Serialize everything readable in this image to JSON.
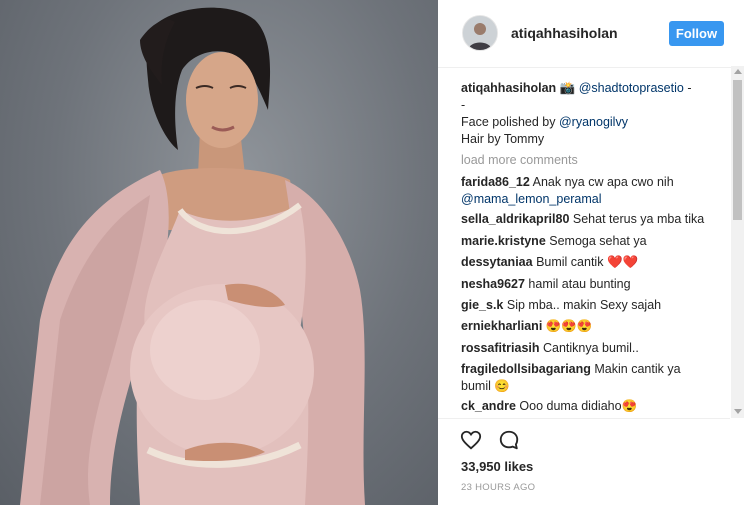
{
  "post": {
    "username": "atiqahhasiholan",
    "follow_label": "Follow",
    "caption": {
      "username": "atiqahhasiholan",
      "camera_emoji": "📸",
      "mention": "@shadtotoprasetio",
      "dash": "-",
      "line2": "-",
      "line3_prefix": "Face polished by ",
      "line3_mention": "@ryanogilvy",
      "line4": "Hair by Tommy"
    },
    "load_more": "load more comments",
    "comments": [
      {
        "user": "farida86_12",
        "text": "Anak nya cw apa cwo nih",
        "mention": "@mama_lemon_peramal"
      },
      {
        "user": "sella_aldrikapril80",
        "text": "Sehat terus ya mba tika"
      },
      {
        "user": "marie.kristyne",
        "text": "Semoga sehat ya"
      },
      {
        "user": "dessytaniaa",
        "text": "Bumil cantik",
        "emoji": "❤️❤️"
      },
      {
        "user": "nesha9627",
        "text": "hamil atau bunting"
      },
      {
        "user": "gie_s.k",
        "text": "Sip mba.. makin Sexy sajah"
      },
      {
        "user": "erniekharliani",
        "text": "",
        "emoji": "😍😍😍"
      },
      {
        "user": "rossafitriasih",
        "text": "Cantiknya bumil.."
      },
      {
        "user": "fragiledollsibagariang",
        "text": "Makin cantik ya",
        "text2": "bumil",
        "emoji": "😊"
      },
      {
        "user": "ck_andre",
        "text": "Ooo duma didiaho",
        "emoji": "😍"
      }
    ],
    "likes": "33,950 likes",
    "time": "23 HOURS AGO",
    "colors": {
      "follow_bg": "#3897f0",
      "mention": "#003569",
      "heart": "#ed4956"
    },
    "icons": [
      "heart-icon",
      "comment-icon"
    ]
  }
}
